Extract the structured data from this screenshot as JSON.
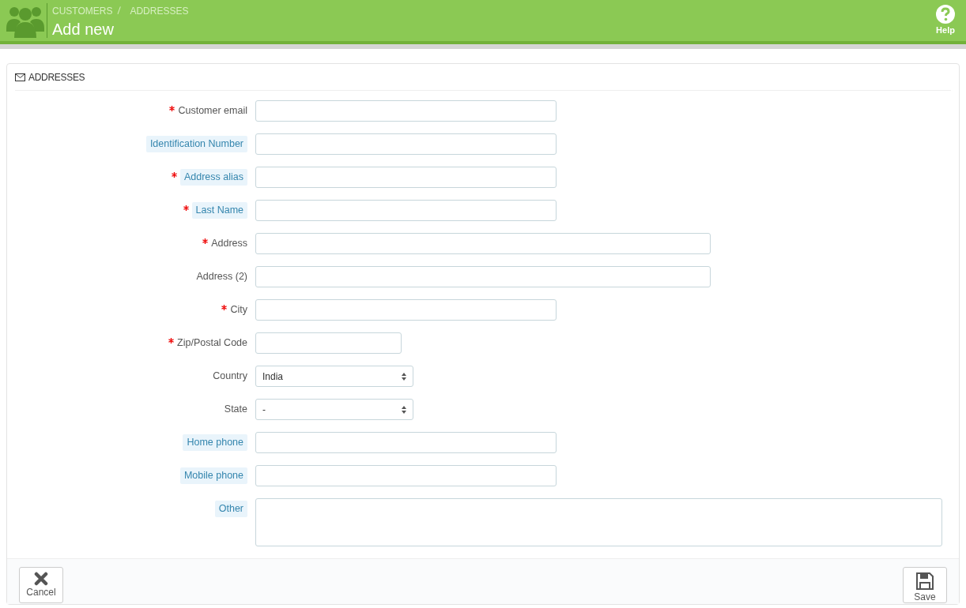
{
  "header": {
    "breadcrumb": [
      "CUSTOMERS",
      "ADDRESSES"
    ],
    "title": "Add new",
    "help": "Help"
  },
  "panel": {
    "title": "ADDRESSES",
    "fields": [
      {
        "label": "Customer email",
        "required": true,
        "hint": false,
        "kind": "text"
      },
      {
        "label": "Identification Number",
        "required": false,
        "hint": true,
        "kind": "text"
      },
      {
        "label": "Address alias",
        "required": true,
        "hint": true,
        "kind": "text"
      },
      {
        "label": "Last Name",
        "required": true,
        "hint": true,
        "kind": "text"
      },
      {
        "label": "Address",
        "required": true,
        "hint": false,
        "kind": "wide"
      },
      {
        "label": "Address (2)",
        "required": false,
        "hint": false,
        "kind": "wide"
      },
      {
        "label": "City",
        "required": true,
        "hint": false,
        "kind": "text"
      },
      {
        "label": "Zip/Postal Code",
        "required": true,
        "hint": false,
        "kind": "short"
      },
      {
        "label": "Country",
        "required": false,
        "hint": false,
        "kind": "select",
        "value": "India"
      },
      {
        "label": "State",
        "required": false,
        "hint": false,
        "kind": "select",
        "value": "-"
      },
      {
        "label": "Home phone",
        "required": false,
        "hint": true,
        "kind": "text"
      },
      {
        "label": "Mobile phone",
        "required": false,
        "hint": true,
        "kind": "text"
      },
      {
        "label": "Other",
        "required": false,
        "hint": true,
        "kind": "textarea"
      }
    ],
    "buttons": [
      {
        "label": "Cancel",
        "kind": "cancel"
      },
      {
        "label": "Save",
        "kind": "save"
      }
    ]
  }
}
